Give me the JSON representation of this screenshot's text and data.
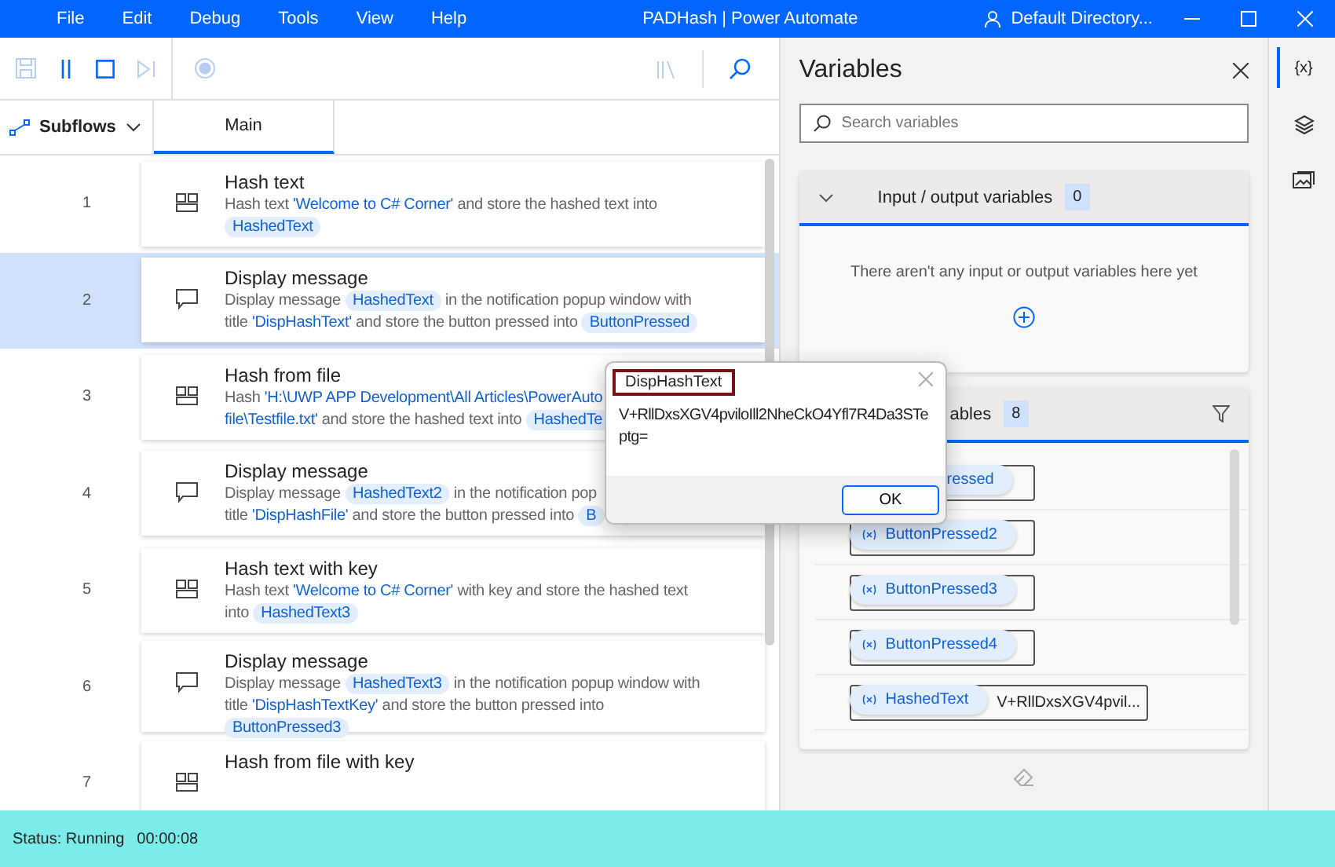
{
  "window": {
    "menu": [
      "File",
      "Edit",
      "Debug",
      "Tools",
      "View",
      "Help"
    ],
    "title": "PADHash | Power Automate",
    "account": "Default Directory..."
  },
  "subflows": {
    "label": "Subflows"
  },
  "tabs": [
    {
      "label": "Main",
      "selected": true
    }
  ],
  "flow": [
    {
      "number": "1",
      "kind": "hash",
      "title": "Hash text",
      "selected": false,
      "segments": [
        {
          "kind": "text",
          "text": "Hash text "
        },
        {
          "kind": "literal",
          "text": "'Welcome to C# Corner'"
        },
        {
          "kind": "text",
          "text": " and store the hashed text into"
        },
        {
          "kind": "break"
        },
        {
          "kind": "var",
          "text": "HashedText"
        }
      ]
    },
    {
      "number": "2",
      "kind": "message",
      "title": "Display message",
      "selected": true,
      "segments": [
        {
          "kind": "text",
          "text": "Display message "
        },
        {
          "kind": "var",
          "text": "HashedText"
        },
        {
          "kind": "text",
          "text": " in the notification popup window with"
        },
        {
          "kind": "break"
        },
        {
          "kind": "text",
          "text": "title "
        },
        {
          "kind": "literal",
          "text": "'DispHashText'"
        },
        {
          "kind": "text",
          "text": " and store the button pressed into "
        },
        {
          "kind": "var",
          "text": "ButtonPressed"
        }
      ]
    },
    {
      "number": "3",
      "kind": "hash",
      "title": "Hash from file",
      "selected": false,
      "segments": [
        {
          "kind": "text",
          "text": "Hash "
        },
        {
          "kind": "literal",
          "text": "'H:\\UWP APP Development\\All Articles\\PowerAuto"
        },
        {
          "kind": "break"
        },
        {
          "kind": "literal",
          "text": "file\\Testfile.txt'"
        },
        {
          "kind": "text",
          "text": " and store the hashed text into "
        },
        {
          "kind": "var",
          "text": "HashedTe"
        }
      ]
    },
    {
      "number": "4",
      "kind": "message",
      "title": "Display message",
      "selected": false,
      "segments": [
        {
          "kind": "text",
          "text": "Display message "
        },
        {
          "kind": "var",
          "text": "HashedText2"
        },
        {
          "kind": "text",
          "text": " in the notification pop"
        },
        {
          "kind": "break"
        },
        {
          "kind": "text",
          "text": "title "
        },
        {
          "kind": "literal",
          "text": "'DispHashFile'"
        },
        {
          "kind": "text",
          "text": " and store the button pressed into "
        },
        {
          "kind": "var",
          "text": "B"
        }
      ]
    },
    {
      "number": "5",
      "kind": "hash",
      "title": "Hash text with key",
      "selected": false,
      "segments": [
        {
          "kind": "text",
          "text": "Hash text "
        },
        {
          "kind": "literal",
          "text": "'Welcome to C# Corner'"
        },
        {
          "kind": "text",
          "text": " with key and store the hashed text"
        },
        {
          "kind": "break"
        },
        {
          "kind": "text",
          "text": "into "
        },
        {
          "kind": "var",
          "text": "HashedText3"
        }
      ]
    },
    {
      "number": "6",
      "kind": "message",
      "title": "Display message",
      "selected": false,
      "segments": [
        {
          "kind": "text",
          "text": "Display message "
        },
        {
          "kind": "var",
          "text": "HashedText3"
        },
        {
          "kind": "text",
          "text": " in the notification popup window with"
        },
        {
          "kind": "break"
        },
        {
          "kind": "text",
          "text": "title "
        },
        {
          "kind": "literal",
          "text": "'DispHashTextKey'"
        },
        {
          "kind": "text",
          "text": " and store the button pressed into"
        },
        {
          "kind": "break"
        },
        {
          "kind": "var",
          "text": "ButtonPressed3"
        }
      ]
    },
    {
      "number": "7",
      "kind": "hash",
      "title": "Hash from file with key",
      "selected": false
    }
  ],
  "dialog": {
    "title": "DispHashText",
    "message": "V+RllDxsXGV4pviloIll2NheCkO4Yfl7R4Da3STeptg=",
    "button": "OK"
  },
  "variables": {
    "title": "Variables",
    "search": {
      "placeholder": "Search variables"
    },
    "io_section": {
      "title": "Input / output variables",
      "count": "0",
      "empty": "There aren't any input or output variables here yet"
    },
    "flow_section": {
      "title": "ables",
      "count": "8",
      "items": [
        {
          "kind": "partial",
          "name": "ressed"
        },
        {
          "kind": "full",
          "name": "ButtonPressed2"
        },
        {
          "kind": "full",
          "name": "ButtonPressed3"
        },
        {
          "kind": "full",
          "name": "ButtonPressed4"
        },
        {
          "kind": "full",
          "name": "HashedText",
          "value": "V+RllDxsXGV4pvil..."
        }
      ]
    }
  },
  "rail": [
    {
      "kind": "text",
      "label": "{x}",
      "selected": true
    },
    {
      "kind": "layers",
      "selected": false
    },
    {
      "kind": "image",
      "selected": false
    }
  ],
  "status": {
    "label": "Status: Running",
    "time": "00:00:08"
  }
}
